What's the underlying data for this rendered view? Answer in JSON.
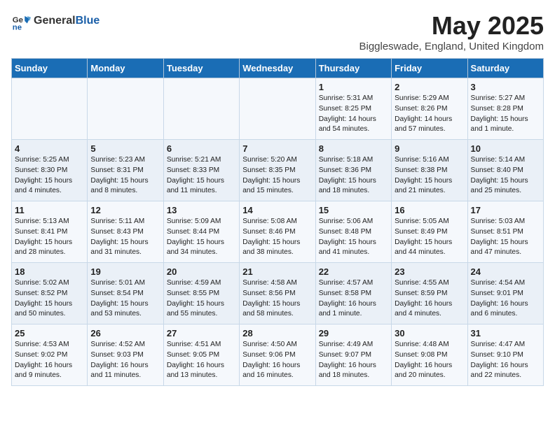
{
  "logo": {
    "general": "General",
    "blue": "Blue"
  },
  "title": "May 2025",
  "location": "Biggleswade, England, United Kingdom",
  "weekdays": [
    "Sunday",
    "Monday",
    "Tuesday",
    "Wednesday",
    "Thursday",
    "Friday",
    "Saturday"
  ],
  "weeks": [
    [
      {
        "day": "",
        "content": ""
      },
      {
        "day": "",
        "content": ""
      },
      {
        "day": "",
        "content": ""
      },
      {
        "day": "",
        "content": ""
      },
      {
        "day": "1",
        "content": "Sunrise: 5:31 AM\nSunset: 8:25 PM\nDaylight: 14 hours\nand 54 minutes."
      },
      {
        "day": "2",
        "content": "Sunrise: 5:29 AM\nSunset: 8:26 PM\nDaylight: 14 hours\nand 57 minutes."
      },
      {
        "day": "3",
        "content": "Sunrise: 5:27 AM\nSunset: 8:28 PM\nDaylight: 15 hours\nand 1 minute."
      }
    ],
    [
      {
        "day": "4",
        "content": "Sunrise: 5:25 AM\nSunset: 8:30 PM\nDaylight: 15 hours\nand 4 minutes."
      },
      {
        "day": "5",
        "content": "Sunrise: 5:23 AM\nSunset: 8:31 PM\nDaylight: 15 hours\nand 8 minutes."
      },
      {
        "day": "6",
        "content": "Sunrise: 5:21 AM\nSunset: 8:33 PM\nDaylight: 15 hours\nand 11 minutes."
      },
      {
        "day": "7",
        "content": "Sunrise: 5:20 AM\nSunset: 8:35 PM\nDaylight: 15 hours\nand 15 minutes."
      },
      {
        "day": "8",
        "content": "Sunrise: 5:18 AM\nSunset: 8:36 PM\nDaylight: 15 hours\nand 18 minutes."
      },
      {
        "day": "9",
        "content": "Sunrise: 5:16 AM\nSunset: 8:38 PM\nDaylight: 15 hours\nand 21 minutes."
      },
      {
        "day": "10",
        "content": "Sunrise: 5:14 AM\nSunset: 8:40 PM\nDaylight: 15 hours\nand 25 minutes."
      }
    ],
    [
      {
        "day": "11",
        "content": "Sunrise: 5:13 AM\nSunset: 8:41 PM\nDaylight: 15 hours\nand 28 minutes."
      },
      {
        "day": "12",
        "content": "Sunrise: 5:11 AM\nSunset: 8:43 PM\nDaylight: 15 hours\nand 31 minutes."
      },
      {
        "day": "13",
        "content": "Sunrise: 5:09 AM\nSunset: 8:44 PM\nDaylight: 15 hours\nand 34 minutes."
      },
      {
        "day": "14",
        "content": "Sunrise: 5:08 AM\nSunset: 8:46 PM\nDaylight: 15 hours\nand 38 minutes."
      },
      {
        "day": "15",
        "content": "Sunrise: 5:06 AM\nSunset: 8:48 PM\nDaylight: 15 hours\nand 41 minutes."
      },
      {
        "day": "16",
        "content": "Sunrise: 5:05 AM\nSunset: 8:49 PM\nDaylight: 15 hours\nand 44 minutes."
      },
      {
        "day": "17",
        "content": "Sunrise: 5:03 AM\nSunset: 8:51 PM\nDaylight: 15 hours\nand 47 minutes."
      }
    ],
    [
      {
        "day": "18",
        "content": "Sunrise: 5:02 AM\nSunset: 8:52 PM\nDaylight: 15 hours\nand 50 minutes."
      },
      {
        "day": "19",
        "content": "Sunrise: 5:01 AM\nSunset: 8:54 PM\nDaylight: 15 hours\nand 53 minutes."
      },
      {
        "day": "20",
        "content": "Sunrise: 4:59 AM\nSunset: 8:55 PM\nDaylight: 15 hours\nand 55 minutes."
      },
      {
        "day": "21",
        "content": "Sunrise: 4:58 AM\nSunset: 8:56 PM\nDaylight: 15 hours\nand 58 minutes."
      },
      {
        "day": "22",
        "content": "Sunrise: 4:57 AM\nSunset: 8:58 PM\nDaylight: 16 hours\nand 1 minute."
      },
      {
        "day": "23",
        "content": "Sunrise: 4:55 AM\nSunset: 8:59 PM\nDaylight: 16 hours\nand 4 minutes."
      },
      {
        "day": "24",
        "content": "Sunrise: 4:54 AM\nSunset: 9:01 PM\nDaylight: 16 hours\nand 6 minutes."
      }
    ],
    [
      {
        "day": "25",
        "content": "Sunrise: 4:53 AM\nSunset: 9:02 PM\nDaylight: 16 hours\nand 9 minutes."
      },
      {
        "day": "26",
        "content": "Sunrise: 4:52 AM\nSunset: 9:03 PM\nDaylight: 16 hours\nand 11 minutes."
      },
      {
        "day": "27",
        "content": "Sunrise: 4:51 AM\nSunset: 9:05 PM\nDaylight: 16 hours\nand 13 minutes."
      },
      {
        "day": "28",
        "content": "Sunrise: 4:50 AM\nSunset: 9:06 PM\nDaylight: 16 hours\nand 16 minutes."
      },
      {
        "day": "29",
        "content": "Sunrise: 4:49 AM\nSunset: 9:07 PM\nDaylight: 16 hours\nand 18 minutes."
      },
      {
        "day": "30",
        "content": "Sunrise: 4:48 AM\nSunset: 9:08 PM\nDaylight: 16 hours\nand 20 minutes."
      },
      {
        "day": "31",
        "content": "Sunrise: 4:47 AM\nSunset: 9:10 PM\nDaylight: 16 hours\nand 22 minutes."
      }
    ]
  ]
}
